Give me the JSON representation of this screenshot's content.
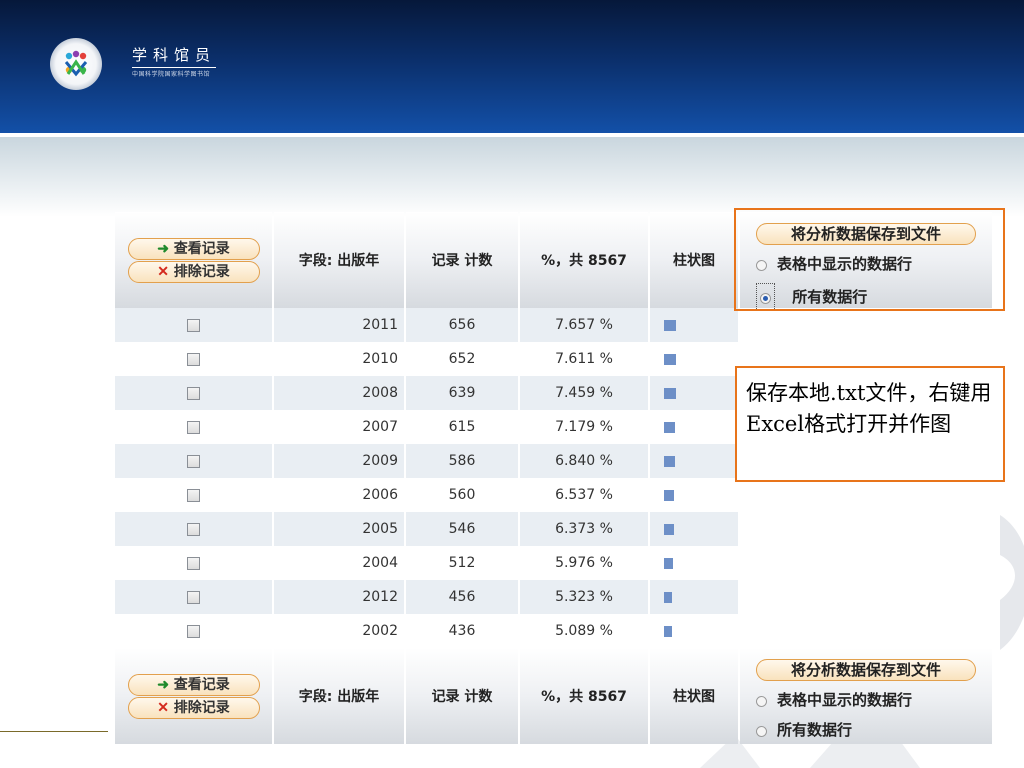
{
  "brand": {
    "title": "学科馆员",
    "subtitle": "中国科学院国家科学图书馆"
  },
  "controls": {
    "view_records": "查看记录",
    "exclude_records": "排除记录",
    "save_to_file": "将分析数据保存到文件",
    "option_table_rows": "表格中显示的数据行",
    "option_all_rows": "所有数据行"
  },
  "columns": {
    "field": "字段: 出版年",
    "count": "记录 计数",
    "percent": "%，共 8567",
    "bar": "柱状图"
  },
  "rows": [
    {
      "year": "2011",
      "count": "656",
      "percent": "7.657 %",
      "share": 7.657
    },
    {
      "year": "2010",
      "count": "652",
      "percent": "7.611 %",
      "share": 7.611
    },
    {
      "year": "2008",
      "count": "639",
      "percent": "7.459 %",
      "share": 7.459
    },
    {
      "year": "2007",
      "count": "615",
      "percent": "7.179 %",
      "share": 7.179
    },
    {
      "year": "2009",
      "count": "586",
      "percent": "6.840 %",
      "share": 6.84
    },
    {
      "year": "2006",
      "count": "560",
      "percent": "6.537 %",
      "share": 6.537
    },
    {
      "year": "2005",
      "count": "546",
      "percent": "6.373 %",
      "share": 6.373
    },
    {
      "year": "2004",
      "count": "512",
      "percent": "5.976 %",
      "share": 5.976
    },
    {
      "year": "2012",
      "count": "456",
      "percent": "5.323 %",
      "share": 5.323
    },
    {
      "year": "2002",
      "count": "436",
      "percent": "5.089 %",
      "share": 5.089
    }
  ],
  "annotation": {
    "text": "保存本地.txt文件，右键用Excel格式打开并作图"
  },
  "colors": {
    "bar": "#6d8fc7",
    "highlight": "#e8741a",
    "header_dark": "#06183a"
  }
}
